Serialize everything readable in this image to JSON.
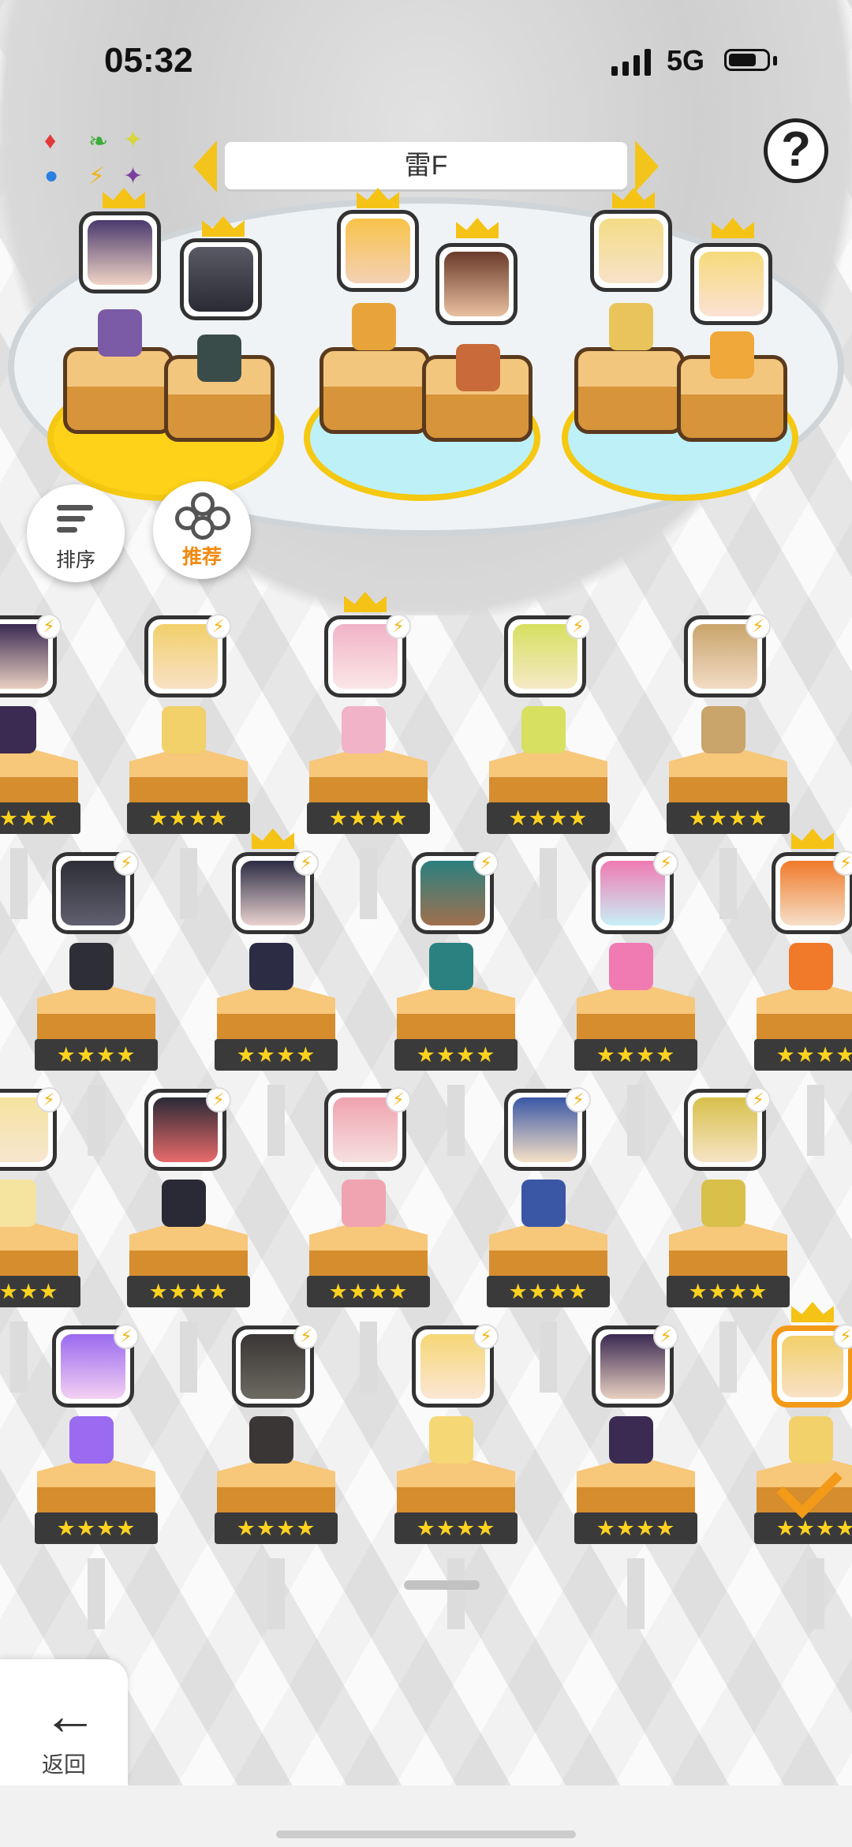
{
  "status_bar": {
    "time": "05:32",
    "network": "5G"
  },
  "floor_selector": {
    "label": "雷F"
  },
  "help": {
    "label": "?"
  },
  "sort_button": {
    "label": "排序"
  },
  "recommend_button": {
    "label": "推荐"
  },
  "back_button": {
    "label": "返回"
  },
  "ratings": {
    "four_star": "★★★★"
  },
  "element_cycle": [
    "♦",
    "❧",
    "✦",
    "●",
    "⚡",
    "✦"
  ],
  "colors": {
    "accent": "#f39a19",
    "gold": "#f5c315",
    "pad_active": "#ffd21a",
    "pad_inactive": "#bdf1f7",
    "star_bar": "#3a3a3a"
  },
  "icons": [
    "sort-icon",
    "recommend-icon",
    "back-arrow-icon",
    "help-icon",
    "crown-icon",
    "bolt-icon",
    "check-icon"
  ]
}
